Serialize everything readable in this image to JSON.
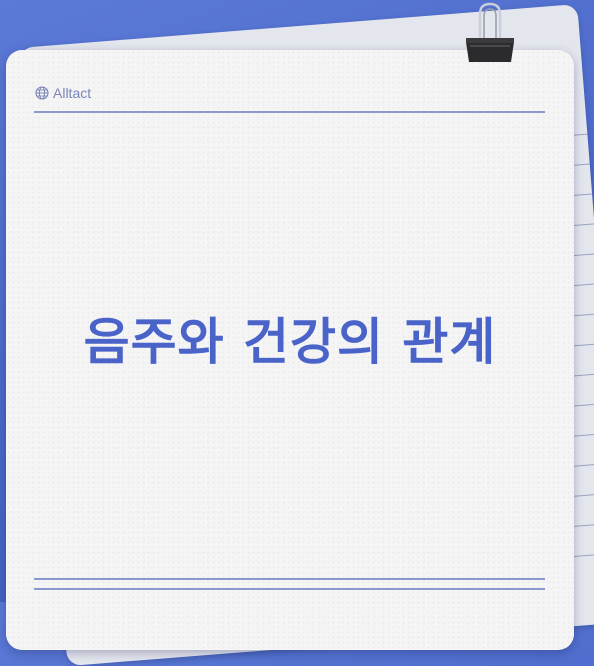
{
  "brand": {
    "icon": "globe-icon",
    "name": "Alltact"
  },
  "title": "음주와 건강의 관계",
  "colors": {
    "background": "#4f6dcc",
    "sheet": "#f5f5f5",
    "title": "#4a63c9",
    "divider": "#8b98cf",
    "brand_text": "#7a84b6"
  }
}
